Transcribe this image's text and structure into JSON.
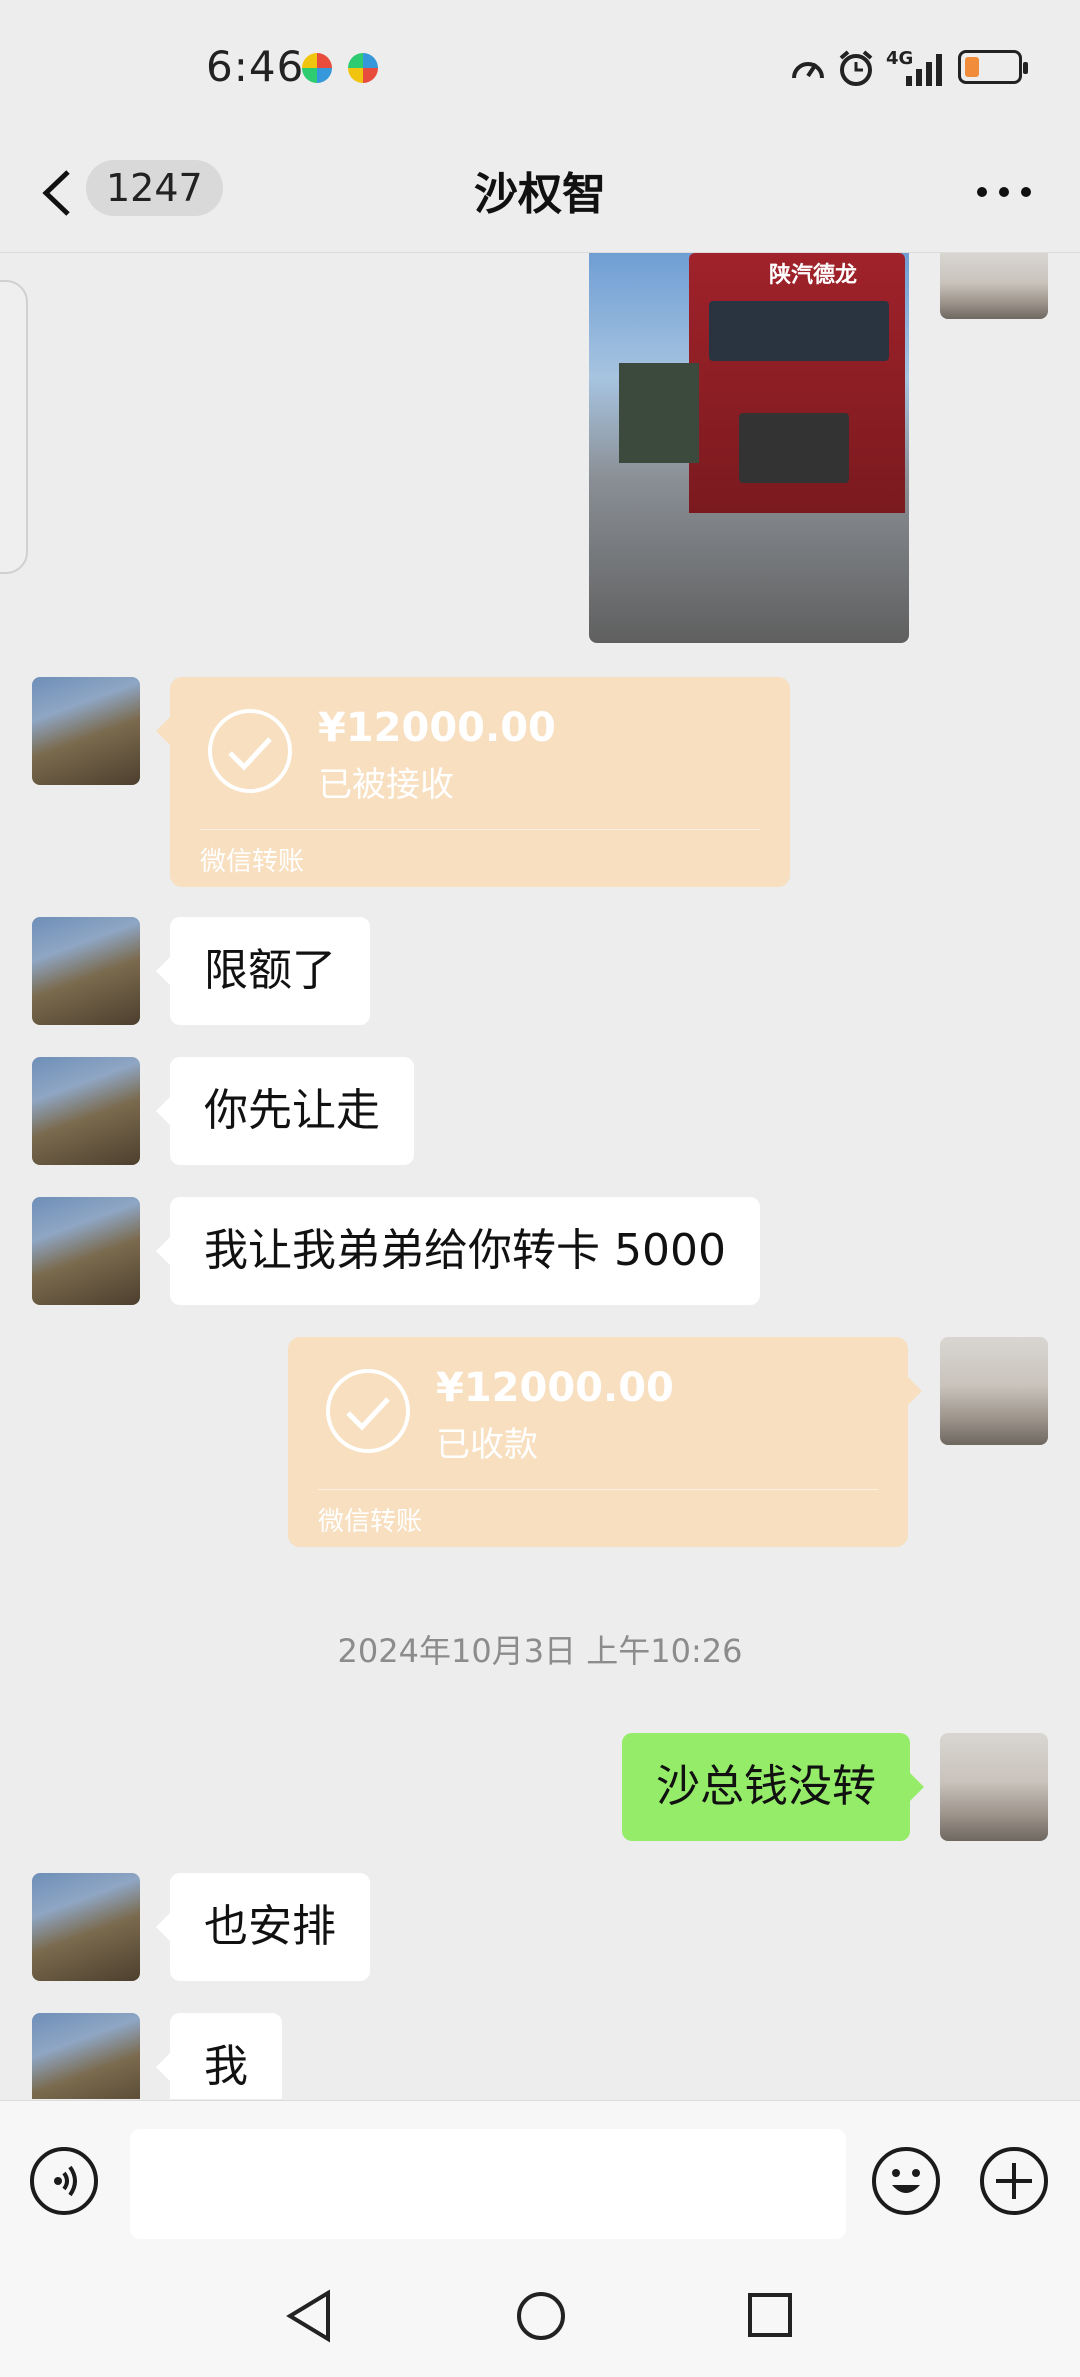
{
  "status_bar": {
    "time": "6:46",
    "network": "4G",
    "battery_color": "#f08c3a"
  },
  "header": {
    "back_icon": "chevron-left-icon",
    "unread_count": "1247",
    "contact_name": "沙权智",
    "more_icon": "more-dots-icon"
  },
  "messages": [
    {
      "type": "image",
      "side": "right",
      "description": "truck-photo",
      "truck_text": "陕汽德龙"
    },
    {
      "type": "transfer",
      "side": "left",
      "amount": "¥12000.00",
      "status": "已被接收",
      "brand": "微信转账"
    },
    {
      "type": "text",
      "side": "left",
      "text": "限额了"
    },
    {
      "type": "text",
      "side": "left",
      "text": "你先让走"
    },
    {
      "type": "text",
      "side": "left",
      "text": "我让我弟弟给你转卡 5000"
    },
    {
      "type": "transfer",
      "side": "right",
      "amount": "¥12000.00",
      "status": "已收款",
      "brand": "微信转账"
    },
    {
      "type": "timestamp",
      "text": "2024年10月3日 上午10:26"
    },
    {
      "type": "text",
      "side": "right",
      "text": "沙总钱没转"
    },
    {
      "type": "text",
      "side": "left",
      "text": "也安排"
    },
    {
      "type": "text",
      "side": "left",
      "text": "我"
    }
  ],
  "input_bar": {
    "voice_icon": "voice-icon",
    "placeholder": "",
    "emoji_icon": "emoji-icon",
    "plus_icon": "plus-icon"
  },
  "nav_bar": {
    "back": "nav-back-icon",
    "home": "nav-home-icon",
    "recents": "nav-recents-icon"
  },
  "colors": {
    "background": "#ededed",
    "bubble_self": "#95ec69",
    "bubble_other": "#ffffff",
    "transfer_card": "#f7dfc0"
  }
}
